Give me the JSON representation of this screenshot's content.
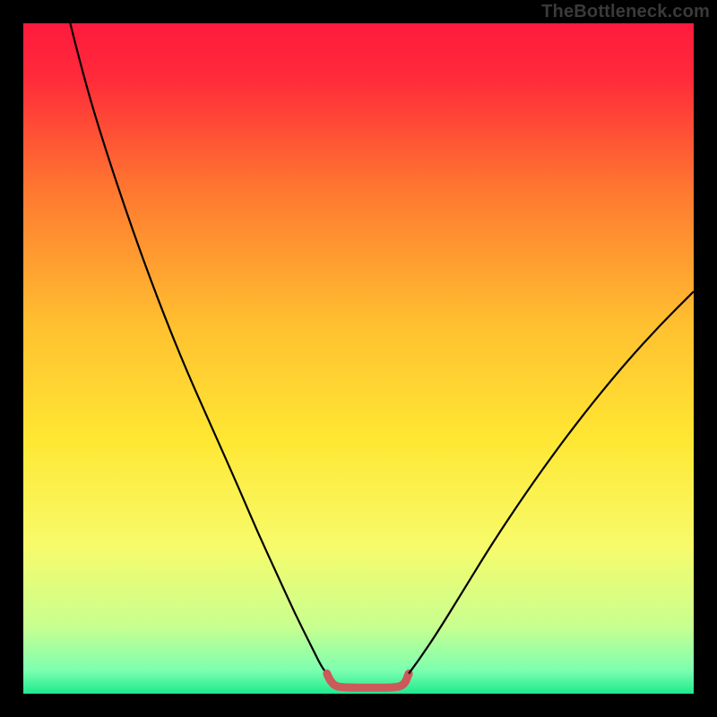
{
  "watermark": "TheBottleneck.com",
  "chart_data": {
    "type": "line",
    "title": "",
    "xlabel": "",
    "ylabel": "",
    "xlim": [
      0,
      100
    ],
    "ylim": [
      0,
      100
    ],
    "gradient_stops": [
      {
        "offset": 0,
        "color": "#ff1a3c"
      },
      {
        "offset": 0.08,
        "color": "#ff2a3a"
      },
      {
        "offset": 0.25,
        "color": "#ff7830"
      },
      {
        "offset": 0.45,
        "color": "#ffc030"
      },
      {
        "offset": 0.62,
        "color": "#ffe733"
      },
      {
        "offset": 0.78,
        "color": "#f7fb6b"
      },
      {
        "offset": 0.9,
        "color": "#c8ff90"
      },
      {
        "offset": 0.965,
        "color": "#7dffb0"
      },
      {
        "offset": 1.0,
        "color": "#1fe98f"
      }
    ],
    "series": [
      {
        "name": "left-curve",
        "stroke": "#000000",
        "stroke_width": 2.2,
        "points": [
          {
            "x": 7.0,
            "y": 100.0
          },
          {
            "x": 9.0,
            "y": 92.0
          },
          {
            "x": 12.0,
            "y": 82.0
          },
          {
            "x": 16.0,
            "y": 70.0
          },
          {
            "x": 20.0,
            "y": 59.0
          },
          {
            "x": 24.0,
            "y": 49.0
          },
          {
            "x": 28.0,
            "y": 40.0
          },
          {
            "x": 32.0,
            "y": 31.0
          },
          {
            "x": 35.0,
            "y": 24.0
          },
          {
            "x": 38.0,
            "y": 17.5
          },
          {
            "x": 40.5,
            "y": 12.0
          },
          {
            "x": 43.0,
            "y": 7.0
          },
          {
            "x": 44.5,
            "y": 4.0
          },
          {
            "x": 45.3,
            "y": 3.0
          }
        ]
      },
      {
        "name": "floor-segment",
        "stroke": "#cc5a5a",
        "stroke_width": 9,
        "linecap": "round",
        "points": [
          {
            "x": 45.3,
            "y": 3.0
          },
          {
            "x": 46.0,
            "y": 1.2
          },
          {
            "x": 48.0,
            "y": 0.9
          },
          {
            "x": 52.0,
            "y": 0.9
          },
          {
            "x": 55.0,
            "y": 0.9
          },
          {
            "x": 56.8,
            "y": 1.2
          },
          {
            "x": 57.5,
            "y": 3.0
          }
        ]
      },
      {
        "name": "right-curve",
        "stroke": "#000000",
        "stroke_width": 2.2,
        "points": [
          {
            "x": 57.5,
            "y": 3.0
          },
          {
            "x": 59.0,
            "y": 5.0
          },
          {
            "x": 62.0,
            "y": 9.5
          },
          {
            "x": 66.0,
            "y": 16.0
          },
          {
            "x": 70.0,
            "y": 22.5
          },
          {
            "x": 75.0,
            "y": 30.0
          },
          {
            "x": 80.0,
            "y": 37.0
          },
          {
            "x": 85.0,
            "y": 43.5
          },
          {
            "x": 90.0,
            "y": 49.5
          },
          {
            "x": 95.0,
            "y": 55.0
          },
          {
            "x": 100.0,
            "y": 60.0
          }
        ]
      }
    ]
  }
}
